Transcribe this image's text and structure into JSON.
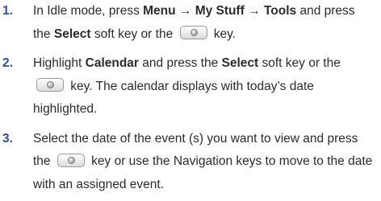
{
  "steps": [
    {
      "number": "1.",
      "p1": "In Idle mode, press ",
      "b1": "Menu → My Stuff → Tools",
      "p2": " and press the ",
      "b2": "Select",
      "p3": " soft key or the ",
      "p4": " key."
    },
    {
      "number": "2.",
      "p1": "Highlight ",
      "b1": "Calendar",
      "p2": " and press the ",
      "b2": "Select",
      "p3": " soft key or the ",
      "p4": " key. The calendar displays with today’s date highlighted."
    },
    {
      "number": "3.",
      "p1": "Select the date of the event (s) you want to view and press the ",
      "p2": " key or use the Navigation keys to move to the date with an assigned event."
    }
  ],
  "icons": {
    "select_key": "select-key-icon"
  }
}
